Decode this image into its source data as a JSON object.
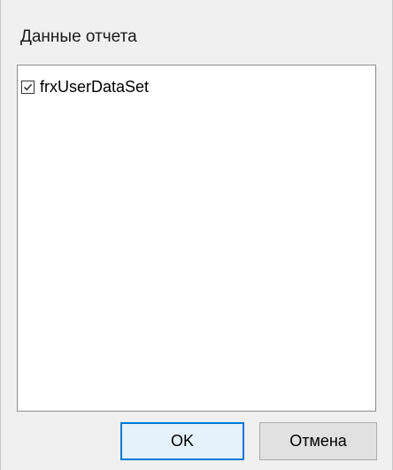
{
  "dialog": {
    "title": "Данные отчета"
  },
  "datasets": {
    "items": [
      {
        "label": "frxUserDataSet",
        "checked": true
      }
    ]
  },
  "buttons": {
    "ok_label": "OK",
    "cancel_label": "Отмена"
  },
  "colors": {
    "accent_focus_border": "#0078d7",
    "dialog_background": "#f0f0f0",
    "list_background": "#ffffff"
  },
  "icons": {
    "checkbox_checked": "checkmark-icon"
  }
}
